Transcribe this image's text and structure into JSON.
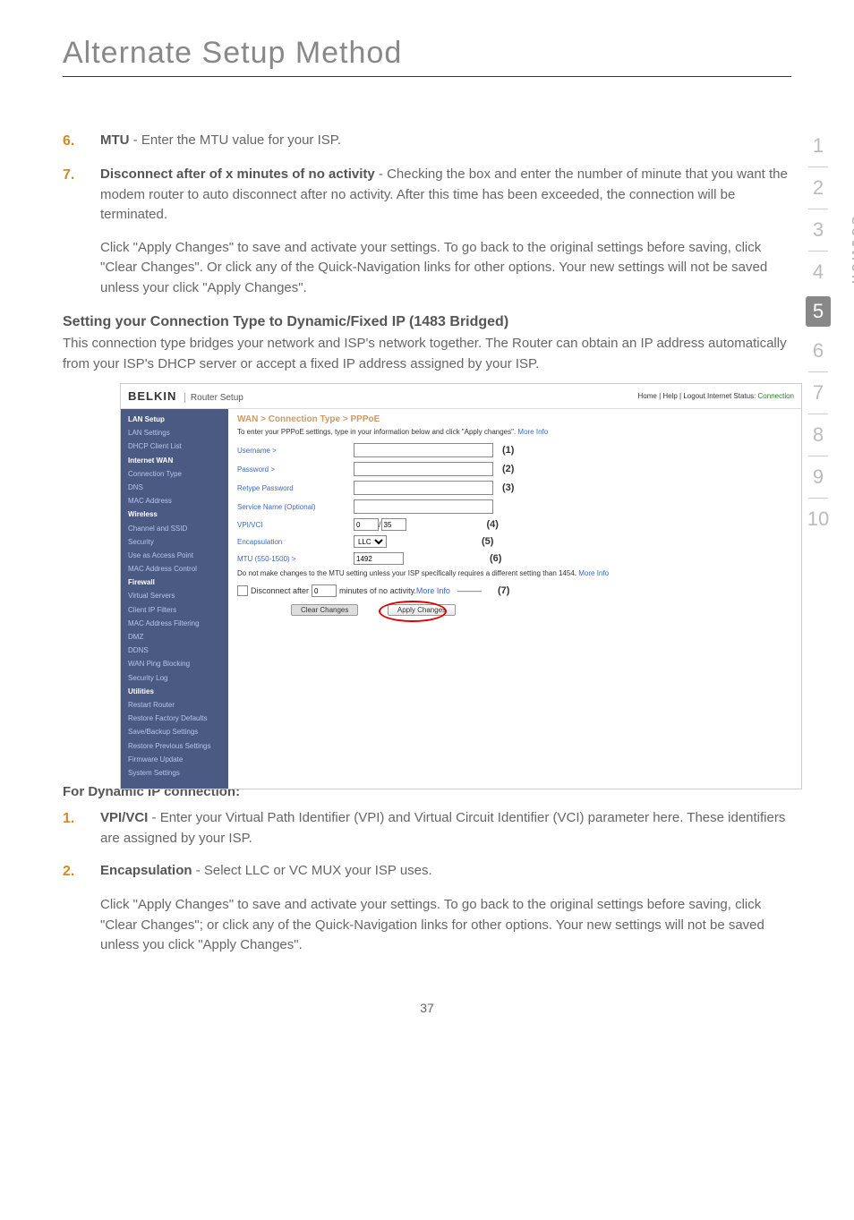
{
  "page": {
    "title": "Alternate Setup Method",
    "page_number": "37"
  },
  "sidebar_nav": {
    "items": [
      "1",
      "2",
      "3",
      "4",
      "5",
      "6",
      "7",
      "8",
      "9",
      "10"
    ],
    "active_index": 4,
    "section_label": "section"
  },
  "items_top": [
    {
      "num": "6.",
      "lead": "MTU",
      "body": " - Enter the MTU value for your ISP."
    },
    {
      "num": "7.",
      "lead": "Disconnect after of x minutes of no activity",
      "body": " - Checking the box and enter the number of minute that you want the modem router to auto disconnect after no activity. After this time has been exceeded, the connection will be terminated."
    }
  ],
  "apply_para_1": "Click \"Apply Changes\" to save and activate your settings. To go back to the original settings before saving, click \"Clear Changes\". Or click any of the Quick-Navigation links for other options. Your new settings will not be saved unless your click \"Apply Changes\".",
  "subhead": {
    "title": "Setting your Connection Type to Dynamic/Fixed IP (1483 Bridged)",
    "body": "This connection type bridges your network and ISP's network together. The Router can obtain an IP address automatically from your ISP's DHCP server or accept a fixed IP address assigned by your ISP."
  },
  "dynamic_head": "For Dynamic IP connection:",
  "items_bottom": [
    {
      "num": "1.",
      "lead": "VPI/VCI",
      "body": " - Enter your Virtual Path Identifier (VPI) and Virtual Circuit Identifier (VCI) parameter here. These identifiers are assigned by your ISP."
    },
    {
      "num": "2.",
      "lead": "Encapsulation",
      "body": " - Select LLC or VC MUX your ISP uses."
    }
  ],
  "apply_para_2": "Click \"Apply Changes\" to save and activate your settings. To go back to the original settings before saving, click \"Clear Changes\"; or click any of the Quick-Navigation links for other options. Your new settings will not be saved unless you click \"Apply Changes\".",
  "router": {
    "logo": "BELKIN",
    "setup_label": "Router Setup",
    "status_prefix": "Home | Help | Logout   Internet Status: ",
    "status_value": "Connection",
    "nav": {
      "groups": [
        {
          "header": "LAN Setup",
          "items": [
            "LAN Settings",
            "DHCP Client List"
          ]
        },
        {
          "header": "Internet WAN",
          "items": [
            "Connection Type",
            "DNS",
            "MAC Address"
          ]
        },
        {
          "header": "Wireless",
          "items": [
            "Channel and SSID",
            "Security",
            "Use as Access Point",
            "MAC Address Control"
          ]
        },
        {
          "header": "Firewall",
          "items": [
            "Virtual Servers",
            "Client IP Filters",
            "MAC Address Filtering",
            "DMZ",
            "DDNS",
            "WAN Ping Blocking",
            "Security Log"
          ]
        },
        {
          "header": "Utilities",
          "items": [
            "Restart Router",
            "Restore Factory Defaults",
            "Save/Backup Settings",
            "Restore Previous Settings",
            "Firmware Update",
            "System Settings"
          ]
        }
      ]
    },
    "breadcrumb": "WAN > Connection Type > PPPoE",
    "hint_prefix": "To enter your PPPoE settings, type in your information below and click \"Apply changes\". ",
    "hint_link": "More Info",
    "rows": {
      "username": "Username >",
      "password": "Password >",
      "retype": "Retype Password",
      "service": "Service Name (Optional)",
      "vpivci": "VPI/VCI",
      "vpi_val": "0",
      "vci_val": "35",
      "encap": "Encapsulation",
      "encap_val": "LLC",
      "mtu": "MTU (550-1500) >",
      "mtu_val": "1492",
      "mtu_note_prefix": "Do not make changes to the MTU setting unless your ISP specifically requires a different setting than 1454. ",
      "mtu_note_link": "More Info",
      "disconnect_label": "Disconnect after",
      "disconnect_val": "0",
      "disconnect_suffix": "minutes of no activity. ",
      "disconnect_link": "More Info"
    },
    "callouts": [
      "(1)",
      "(2)",
      "(3)",
      "(4)",
      "(5)",
      "(6)",
      "(7)"
    ],
    "buttons": {
      "clear": "Clear Changes",
      "apply": "Apply Changes"
    }
  }
}
